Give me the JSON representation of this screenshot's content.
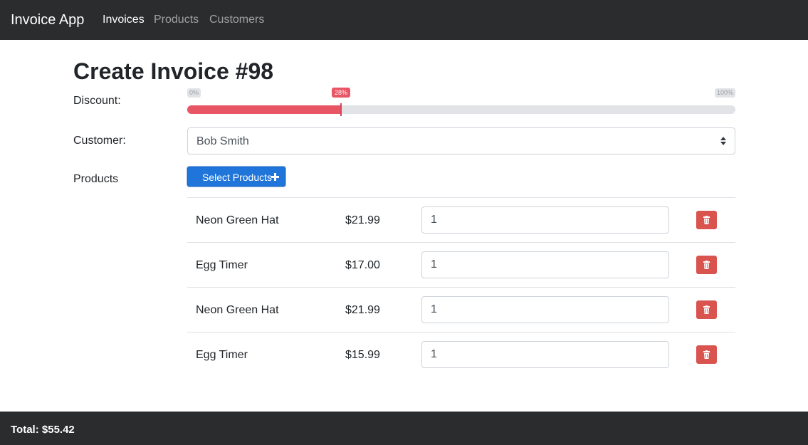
{
  "navbar": {
    "brand": "Invoice App",
    "links": [
      {
        "label": "Invoices",
        "active": true
      },
      {
        "label": "Products",
        "active": false
      },
      {
        "label": "Customers",
        "active": false
      }
    ]
  },
  "page": {
    "title": "Create Invoice #98"
  },
  "form": {
    "discount_label": "Discount:",
    "customer_label": "Customer:",
    "products_label": "Products"
  },
  "discount": {
    "min_label": "0%",
    "max_label": "100%",
    "value_label": "28%",
    "value": 28,
    "min": 0,
    "max": 100
  },
  "customer": {
    "selected": "Bob Smith"
  },
  "select_products_button": {
    "label": "Select Products",
    "icon": "plus-icon"
  },
  "products": [
    {
      "name": "Neon Green Hat",
      "price": "$21.99",
      "quantity": "1"
    },
    {
      "name": "Egg Timer",
      "price": "$17.00",
      "quantity": "1"
    },
    {
      "name": "Neon Green Hat",
      "price": "$21.99",
      "quantity": "1"
    },
    {
      "name": "Egg Timer",
      "price": "$15.99",
      "quantity": "1"
    }
  ],
  "footer": {
    "total": "Total: $55.42"
  },
  "colors": {
    "navbar_bg": "#2b2c2e",
    "slider_fill": "#e85564",
    "primary": "#1f75d9",
    "danger": "#d9534f"
  }
}
